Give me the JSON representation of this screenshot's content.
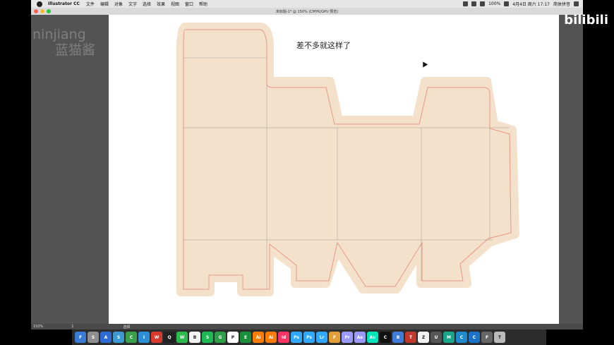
{
  "menubar": {
    "app_name": "Illustrator CC",
    "items": [
      "文件",
      "编辑",
      "对象",
      "文字",
      "选择",
      "效果",
      "视图",
      "窗口",
      "帮助"
    ],
    "status_text": "100%",
    "date_time": "4月4日 周六 17:17",
    "input_method": "简体拼音"
  },
  "window": {
    "title": "未标题-1* @ 150% (CMYK/GPU 预览)"
  },
  "watermark": {
    "line1": "ninjiang",
    "line2": "蓝猫酱"
  },
  "logo": "bilibili",
  "canvas": {
    "note": "差不多就这样了",
    "fill_color": "#f4e1cb",
    "cut_color": "#e79883",
    "fold_color": "#8a8a8a"
  },
  "statusbar": {
    "zoom": "150%",
    "page": "1",
    "tool": "选择"
  },
  "dock": {
    "apps": [
      {
        "label": "F",
        "color": "#3a7bd5"
      },
      {
        "label": "S",
        "color": "#8e8e8e"
      },
      {
        "label": "A",
        "color": "#2d6ad4"
      },
      {
        "label": "S",
        "color": "#3d9ad1"
      },
      {
        "label": "C",
        "color": "#3aa14a"
      },
      {
        "label": "I",
        "color": "#2b8fd6"
      },
      {
        "label": "W",
        "color": "#d83b2d"
      },
      {
        "label": "Q",
        "color": "#222222"
      },
      {
        "label": "W",
        "color": "#2dbb4e"
      },
      {
        "label": "B",
        "color": "#f3f3f3"
      },
      {
        "label": "S",
        "color": "#1db954"
      },
      {
        "label": "G",
        "color": "#2e9e47"
      },
      {
        "label": "P",
        "color": "#ffffff"
      },
      {
        "label": "E",
        "color": "#1a8f3a"
      },
      {
        "label": "Ai",
        "color": "#ff7c00"
      },
      {
        "label": "Ai",
        "color": "#ff7c00"
      },
      {
        "label": "Id",
        "color": "#ff3366"
      },
      {
        "label": "Ps",
        "color": "#31a8ff"
      },
      {
        "label": "Ps",
        "color": "#31a8ff"
      },
      {
        "label": "Lr",
        "color": "#31a8ff"
      },
      {
        "label": "F",
        "color": "#e1a037"
      },
      {
        "label": "Pr",
        "color": "#9999ff"
      },
      {
        "label": "Ae",
        "color": "#9999ff"
      },
      {
        "label": "Au",
        "color": "#00e4bb"
      },
      {
        "label": "C",
        "color": "#111111"
      },
      {
        "label": "B",
        "color": "#3f7bd8"
      },
      {
        "label": "T",
        "color": "#c0392b"
      },
      {
        "label": "Z",
        "color": "#f0f0f0"
      },
      {
        "label": "U",
        "color": "#555555"
      },
      {
        "label": "M",
        "color": "#1aa58a"
      },
      {
        "label": "C",
        "color": "#1f8acb"
      },
      {
        "label": "C",
        "color": "#1a73c9"
      },
      {
        "label": "F",
        "color": "#666666"
      },
      {
        "label": "T",
        "color": "#bbbbbb"
      }
    ]
  }
}
